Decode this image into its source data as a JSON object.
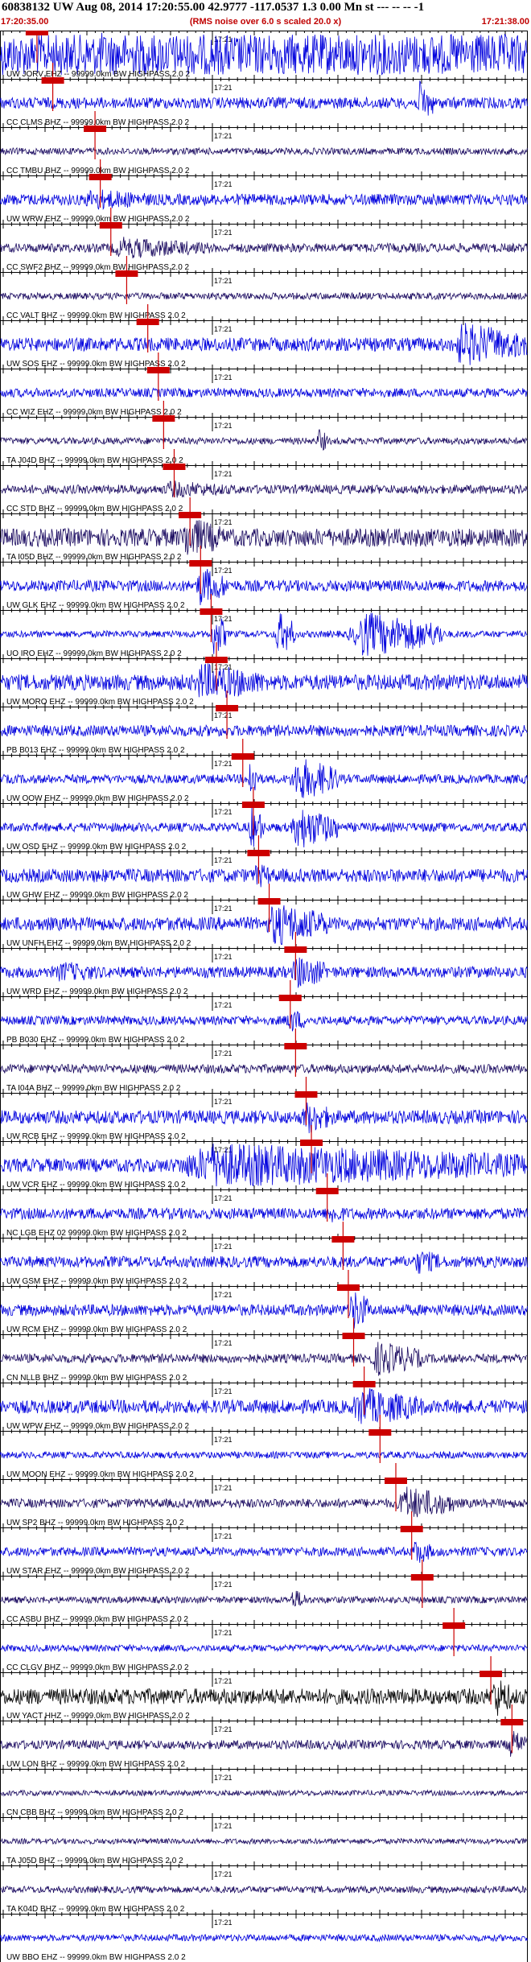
{
  "header": {
    "title": "60838132 UW Aug 08, 2014 17:20:55.00   42.9777 -117.0537  1.3 0.00 Mn st --- -- --  -1",
    "start_time": "17:20:35.00",
    "note": "(RMS noise over 6.0 s scaled 20.0 x)",
    "end_time": "17:21:38.00"
  },
  "time_marker": "17:21",
  "colors": {
    "trace_blue": "#0000dd",
    "trace_dark": "#1a0a60",
    "pick_red": "#cc0000",
    "axis": "#000000"
  },
  "traces": [
    {
      "label": "UW JORV EHZ -- 99999.0km BW  HIGHPASS  2.0  2",
      "color": "blue",
      "amp": 0.9,
      "events": [
        [
          0.16,
          0.35,
          1.0
        ]
      ],
      "pick": 0.07
    },
    {
      "label": "CC CLMS BHZ -- 99999.0km BW  HIGHPASS  2.0  2",
      "color": "blue",
      "amp": 0.25,
      "events": [
        [
          0.79,
          0.82,
          1.0
        ]
      ],
      "pick": 0.1
    },
    {
      "label": "CC TMBU BHZ -- 99999.0km BW  HIGHPASS  2.0  2",
      "color": "dark",
      "amp": 0.15,
      "events": [],
      "pick": 0.18
    },
    {
      "label": "UW WRW EHZ -- 99999.0km BW  HIGHPASS  2.0  2",
      "color": "blue",
      "amp": 0.25,
      "events": [
        [
          0.15,
          0.3,
          0.5
        ]
      ],
      "pick": 0.19
    },
    {
      "label": "CC SWF2 BHZ -- 99999.0km BW  HIGHPASS  2.0  2",
      "color": "dark",
      "amp": 0.2,
      "events": [
        [
          0.2,
          0.4,
          0.5
        ]
      ],
      "pick": 0.21
    },
    {
      "label": "CC VALT BHZ -- 99999.0km BW  HIGHPASS  2.0  2",
      "color": "dark",
      "amp": 0.15,
      "events": [],
      "pick": 0.24
    },
    {
      "label": "UW SOS EHZ -- 99999.0km BW  HIGHPASS  2.0  2",
      "color": "blue",
      "amp": 0.3,
      "events": [
        [
          0.85,
          1.0,
          1.0
        ]
      ],
      "pick": 0.28
    },
    {
      "label": "CC WIZ EHZ -- 99999.0km BW  HIGHPASS  2.0  2",
      "color": "blue",
      "amp": 0.2,
      "events": [],
      "pick": 0.3
    },
    {
      "label": "TA J04D BHZ -- 99999.0km BW  HIGHPASS  2.0  2",
      "color": "dark",
      "amp": 0.15,
      "events": [
        [
          0.6,
          0.62,
          0.6
        ]
      ],
      "pick": 0.31
    },
    {
      "label": "CC STD BHZ -- 99999.0km BW  HIGHPASS  2.0  2",
      "color": "dark",
      "amp": 0.2,
      "events": [
        [
          0.3,
          0.45,
          0.4
        ]
      ],
      "pick": 0.33
    },
    {
      "label": "TA I05D BHZ -- 99999.0km BW  HIGHPASS  2.0  2",
      "color": "dark",
      "amp": 0.4,
      "events": [
        [
          0.34,
          0.42,
          1.0
        ]
      ],
      "pick": 0.36
    },
    {
      "label": "UW GLK EHZ -- 99999.0km BW  HIGHPASS  2.0  2",
      "color": "blue",
      "amp": 0.25,
      "events": [
        [
          0.37,
          0.43,
          0.9
        ]
      ],
      "pick": 0.38
    },
    {
      "label": "UO IRO EHZ -- 99999.0km BW  HIGHPASS  2.0  2",
      "color": "blue",
      "amp": 0.15,
      "events": [
        [
          0.4,
          0.43,
          1.0
        ],
        [
          0.52,
          0.56,
          1.0
        ],
        [
          0.66,
          0.84,
          1.0
        ]
      ],
      "pick": 0.4
    },
    {
      "label": "UW MORO EHZ -- 99999.0km BW  HIGHPASS  2.0  2",
      "color": "blue",
      "amp": 0.35,
      "events": [
        [
          0.36,
          0.5,
          0.9
        ]
      ],
      "pick": 0.41
    },
    {
      "label": "PB B013 EHZ -- 99999.0km BW  HIGHPASS  2.0  2",
      "color": "blue",
      "amp": 0.25,
      "events": [],
      "pick": 0.43
    },
    {
      "label": "UW OOW EHZ -- 99999.0km BW  HIGHPASS  2.0  2",
      "color": "blue",
      "amp": 0.2,
      "events": [
        [
          0.47,
          0.49,
          1.0
        ],
        [
          0.55,
          0.64,
          1.0
        ]
      ],
      "pick": 0.46
    },
    {
      "label": "UW OSD EHZ -- 99999.0km BW  HIGHPASS  2.0  2",
      "color": "blue",
      "amp": 0.2,
      "events": [
        [
          0.47,
          0.5,
          1.0
        ],
        [
          0.55,
          0.64,
          1.0
        ]
      ],
      "pick": 0.48
    },
    {
      "label": "UW GHW EHZ -- 99999.0km BW  HIGHPASS  2.0  2",
      "color": "blue",
      "amp": 0.3,
      "events": [
        [
          0.48,
          0.52,
          0.6
        ]
      ],
      "pick": 0.49
    },
    {
      "label": "UW UNFH EHZ -- 99999.0km BW  HIGHPASS  2.0  2",
      "color": "blue",
      "amp": 0.3,
      "events": [
        [
          0.5,
          0.62,
          1.0
        ]
      ],
      "pick": 0.51
    },
    {
      "label": "UW WRD EHZ -- 99999.0km BW  HIGHPASS  2.0  2",
      "color": "blue",
      "amp": 0.25,
      "events": [
        [
          0.1,
          0.2,
          0.5
        ],
        [
          0.55,
          0.62,
          0.8
        ]
      ],
      "pick": 0.56
    },
    {
      "label": "PB B030 EHZ -- 99999.0km BW  HIGHPASS  2.0  2",
      "color": "blue",
      "amp": 0.2,
      "events": [
        [
          0.54,
          0.58,
          0.6
        ]
      ],
      "pick": 0.55
    },
    {
      "label": "TA I04A BHZ -- 99999.0km BW  HIGHPASS  2.0  2",
      "color": "dark",
      "amp": 0.2,
      "events": [],
      "pick": 0.56
    },
    {
      "label": "UW RCB EHZ -- 99999.0km BW  HIGHPASS  2.0  2",
      "color": "blue",
      "amp": 0.3,
      "events": [
        [
          0.57,
          0.63,
          0.8
        ]
      ],
      "pick": 0.58
    },
    {
      "label": "UW VCR EHZ -- 99999.0km BW  HIGHPASS  2.0  2",
      "color": "blue",
      "amp": 0.3,
      "events": [
        [
          0.3,
          1.0,
          1.0
        ]
      ],
      "pick": 0.59
    },
    {
      "label": "NC LGB EHZ 02 99999.0km BW  HIGHPASS  2.0  2",
      "color": "blue",
      "amp": 0.25,
      "events": [
        [
          0.62,
          0.66,
          0.5
        ]
      ],
      "pick": 0.62
    },
    {
      "label": "UW GSM EHZ -- 99999.0km BW  HIGHPASS  2.0  2",
      "color": "blue",
      "amp": 0.25,
      "events": [
        [
          0.78,
          0.84,
          0.6
        ]
      ],
      "pick": 0.65
    },
    {
      "label": "UW RCM EHZ -- 99999.0km BW  HIGHPASS  2.0  2",
      "color": "blue",
      "amp": 0.25,
      "events": [
        [
          0.66,
          0.7,
          1.0
        ]
      ],
      "pick": 0.66
    },
    {
      "label": "CN NLLB BHZ -- 99999.0km BW  HIGHPASS  2.0  2",
      "color": "dark",
      "amp": 0.2,
      "events": [
        [
          0.7,
          0.8,
          0.8
        ]
      ],
      "pick": 0.67
    },
    {
      "label": "UW WPW EHZ -- 99999.0km BW  HIGHPASS  2.0  2",
      "color": "blue",
      "amp": 0.3,
      "events": [
        [
          0.66,
          0.8,
          0.9
        ]
      ],
      "pick": 0.69
    },
    {
      "label": "UW MOON EHZ -- 99999.0km BW  HIGHPASS  2.0  2",
      "color": "blue",
      "amp": 0.15,
      "events": [],
      "pick": 0.72
    },
    {
      "label": "UW SP2 BHZ -- 99999.0km BW  HIGHPASS  2.0  2",
      "color": "dark",
      "amp": 0.2,
      "events": [
        [
          0.75,
          0.86,
          0.8
        ]
      ],
      "pick": 0.75
    },
    {
      "label": "UW STAR EHZ -- 99999.0km BW  HIGHPASS  2.0  2",
      "color": "blue",
      "amp": 0.2,
      "events": [
        [
          0.78,
          0.82,
          0.6
        ]
      ],
      "pick": 0.78
    },
    {
      "label": "CC ASBU BHZ -- 99999.0km BW  HIGHPASS  2.0  2",
      "color": "dark",
      "amp": 0.15,
      "events": [
        [
          0.55,
          0.58,
          0.5
        ]
      ],
      "pick": 0.8
    },
    {
      "label": "CC CLGV BHZ -- 99999.0km BW  HIGHPASS  2.0  2",
      "color": "blue",
      "amp": 0.15,
      "events": [],
      "pick": 0.86
    },
    {
      "label": "UW YACT HHZ -- 99999.0km BW  HIGHPASS  2.0  2",
      "color": "black",
      "amp": 0.35,
      "events": [
        [
          0.93,
          0.97,
          1.0
        ]
      ],
      "pick": 0.93
    },
    {
      "label": "UW LON BHZ -- 99999.0km BW  HIGHPASS  2.0  2",
      "color": "dark",
      "amp": 0.2,
      "events": [
        [
          0.96,
          1.0,
          0.7
        ]
      ],
      "pick": 0.97
    },
    {
      "label": "CN CBB BHZ -- 99999.0km BW  HIGHPASS  2.0  2",
      "color": "dark",
      "amp": 0.12,
      "events": [],
      "pick": null
    },
    {
      "label": "TA J05D BHZ -- 99999.0km BW  HIGHPASS  2.0  2",
      "color": "dark",
      "amp": 0.12,
      "events": [],
      "pick": null
    },
    {
      "label": "TA K04D BHZ -- 99999.0km BW  HIGHPASS  2.0  2",
      "color": "dark",
      "amp": 0.15,
      "events": [],
      "pick": null
    },
    {
      "label": "UW BBO EHZ -- 99999.0km BW  HIGHPASS  2.0  2",
      "color": "blue",
      "amp": 0.15,
      "events": [],
      "pick": null
    }
  ]
}
